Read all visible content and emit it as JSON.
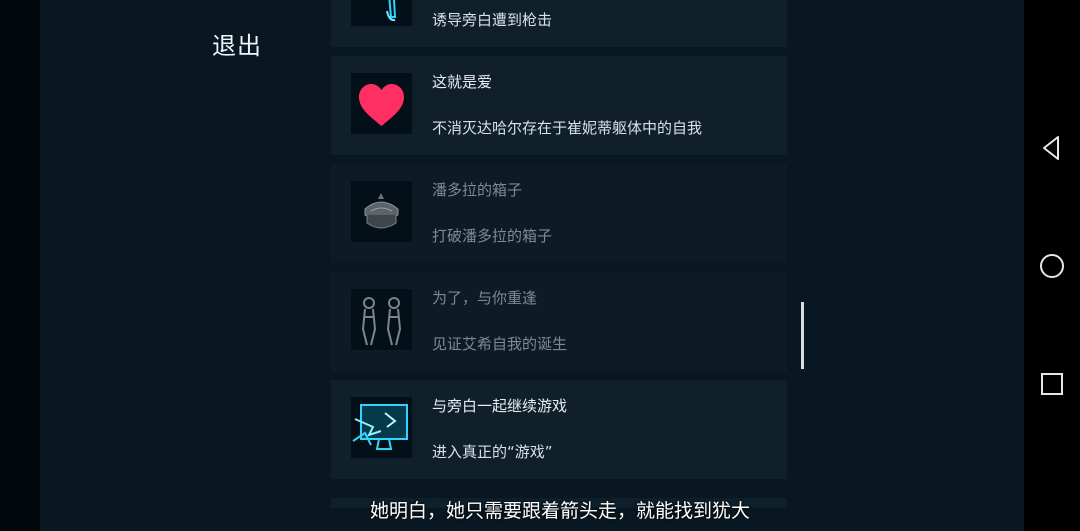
{
  "header": {
    "exit_label": "退出"
  },
  "achievements": [
    {
      "title": "",
      "description": "诱导旁白遭到枪击",
      "icon": "figure-icon",
      "locked": false
    },
    {
      "title": "这就是爱",
      "description": "不消灭达哈尔存在于崔妮蒂躯体中的自我",
      "icon": "heart-icon",
      "locked": false
    },
    {
      "title": "潘多拉的箱子",
      "description": "打破潘多拉的箱子",
      "icon": "box-icon",
      "locked": true
    },
    {
      "title": "为了，与你重逢",
      "description": "见证艾希自我的诞生",
      "icon": "twin-figures-icon",
      "locked": true
    },
    {
      "title": "与旁白一起继续游戏",
      "description": "进入真正的“游戏”",
      "icon": "monitor-icon",
      "locked": false
    }
  ],
  "subtitle": "她明白，她只需要跟着箭头走，就能找到犹大",
  "colors": {
    "accent_heart": "#ff2f63",
    "accent_cyan": "#2fd4ff"
  },
  "system_nav": {
    "back": "back-icon",
    "home": "home-icon",
    "recents": "recents-icon"
  }
}
